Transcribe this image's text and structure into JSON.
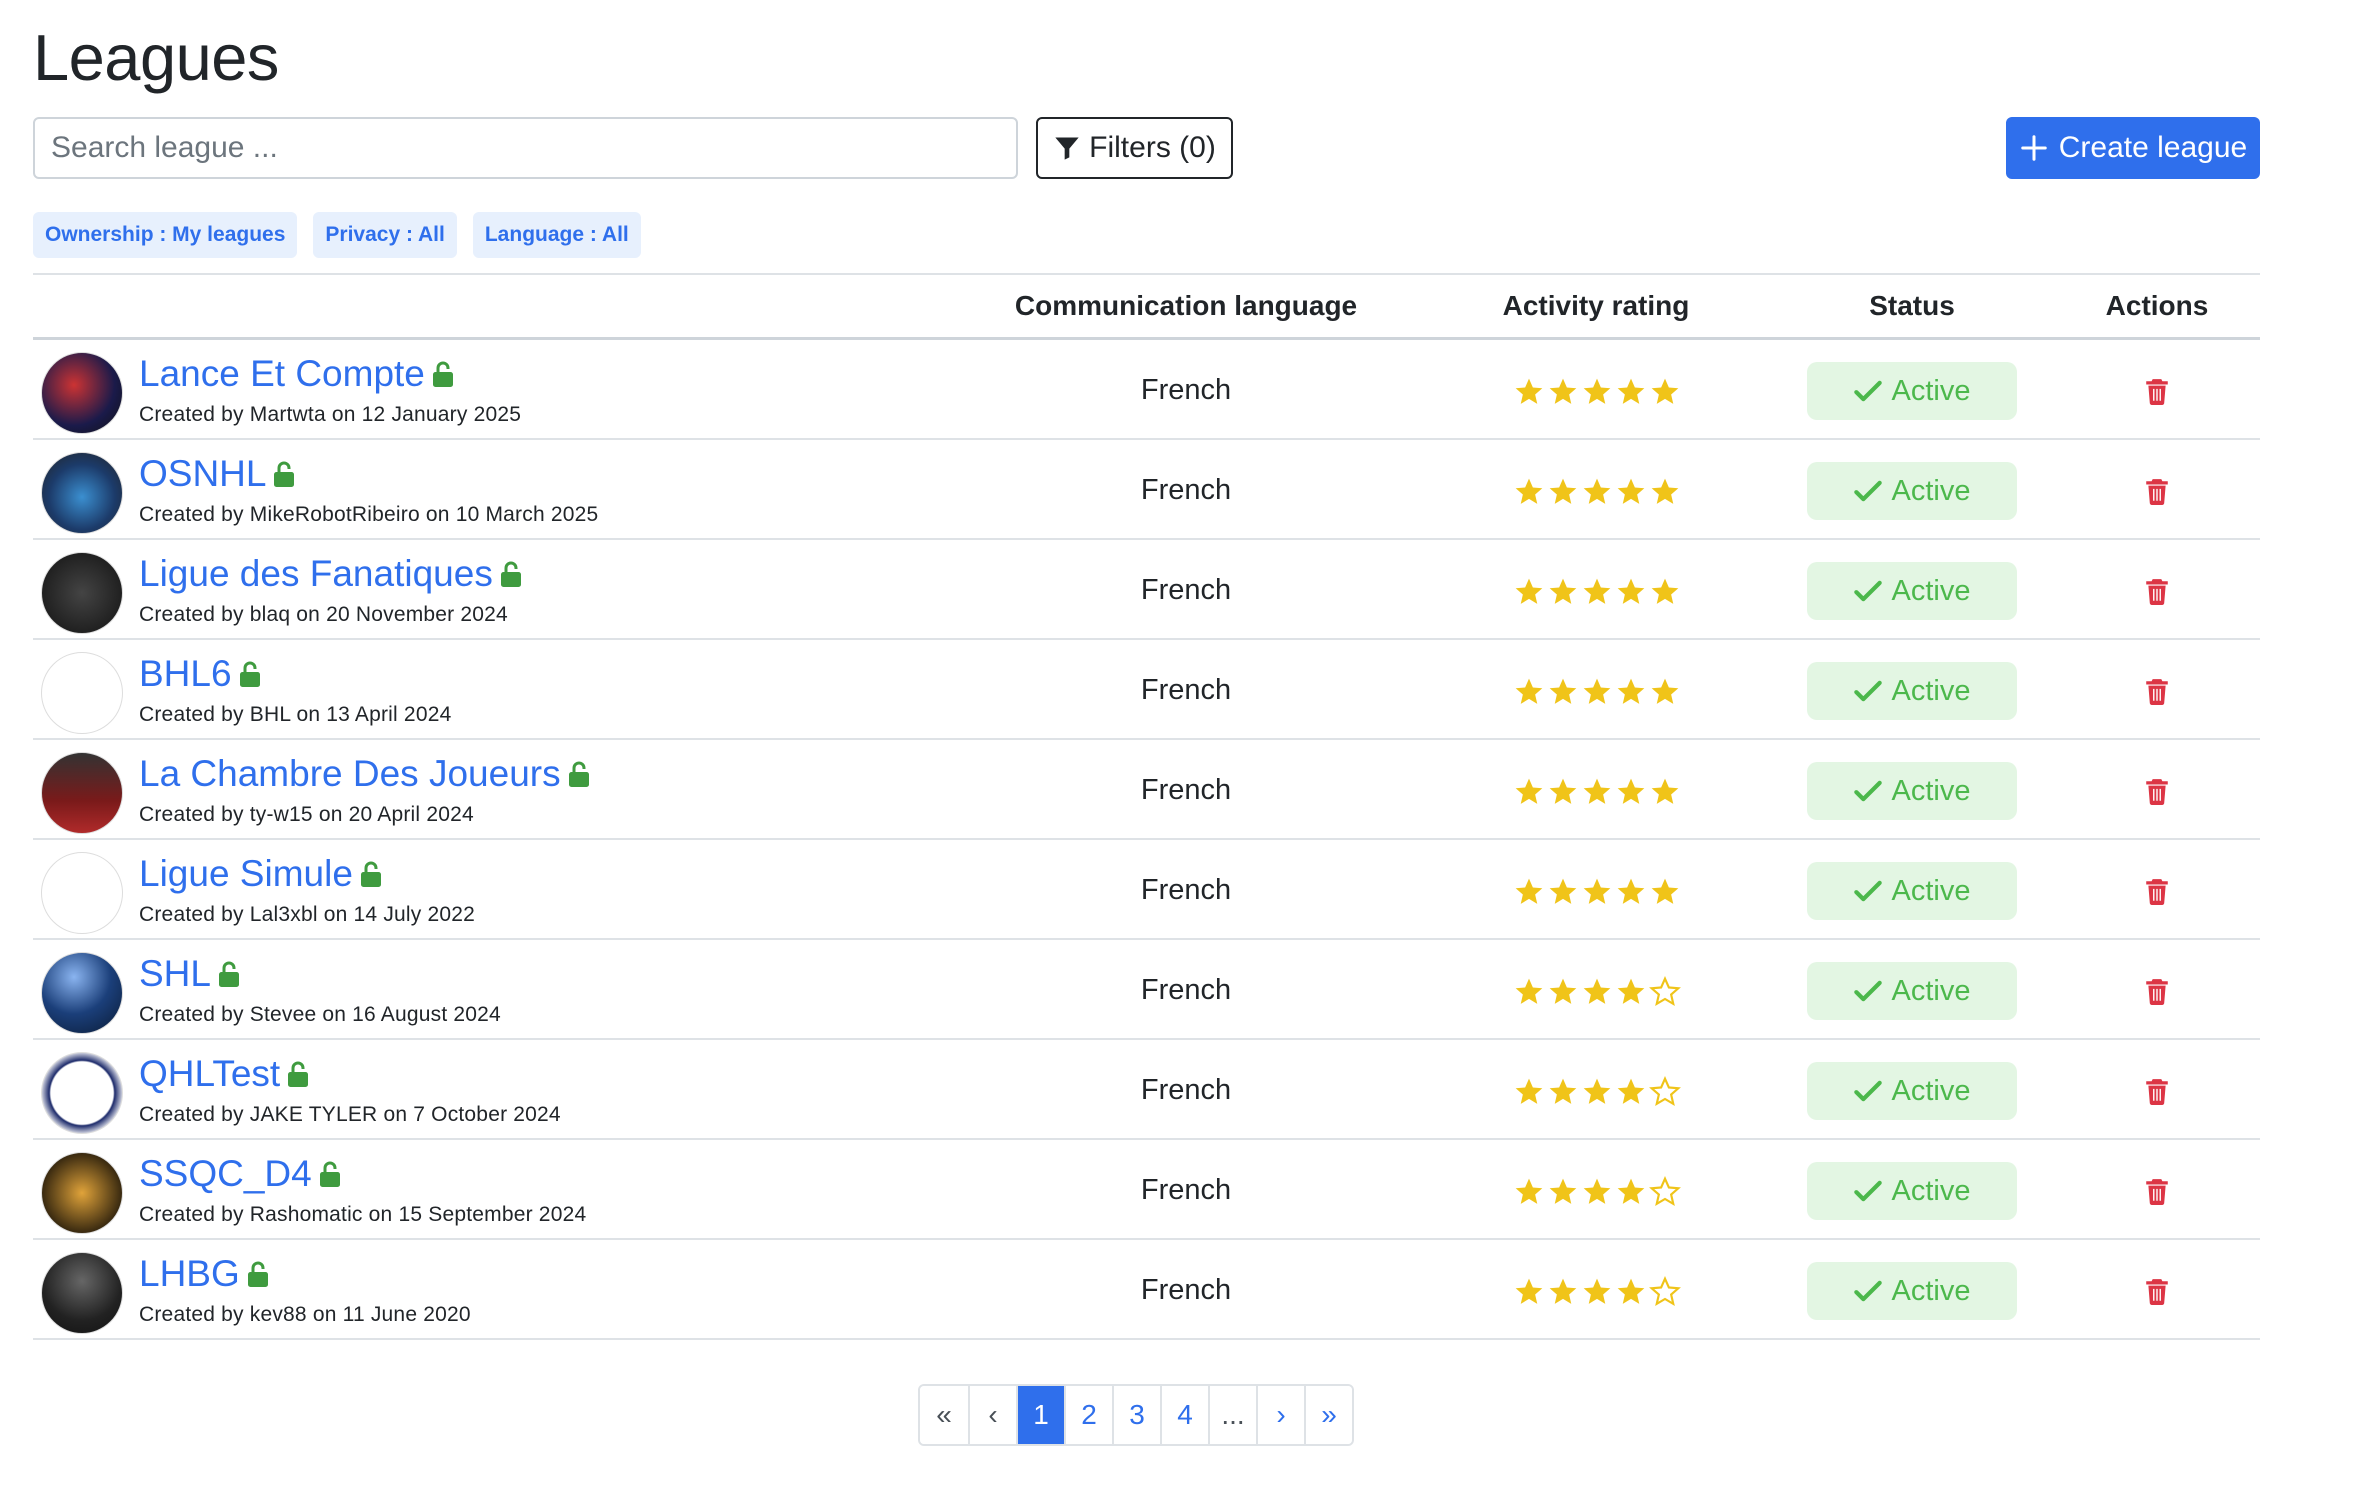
{
  "page": {
    "title": "Leagues"
  },
  "search": {
    "placeholder": "Search league ..."
  },
  "filters_button": {
    "label": "Filters (0)"
  },
  "create_button": {
    "label": "Create league"
  },
  "chips": [
    {
      "label": "Ownership : My leagues"
    },
    {
      "label": "Privacy : All"
    },
    {
      "label": "Language : All"
    }
  ],
  "table": {
    "headers": {
      "language": "Communication language",
      "activity": "Activity rating",
      "status": "Status",
      "actions": "Actions"
    },
    "rows": [
      {
        "name": "Lance Et Compte",
        "created": "Created by Martwta on 12 January 2025",
        "language": "French",
        "rating": 5,
        "status": "Active"
      },
      {
        "name": "OSNHL",
        "created": "Created by MikeRobotRibeiro on 10 March 2025",
        "language": "French",
        "rating": 5,
        "status": "Active"
      },
      {
        "name": "Ligue des Fanatiques",
        "created": "Created by blaq on 20 November 2024",
        "language": "French",
        "rating": 5,
        "status": "Active"
      },
      {
        "name": "BHL6",
        "created": "Created by BHL on 13 April 2024",
        "language": "French",
        "rating": 5,
        "status": "Active"
      },
      {
        "name": "La Chambre Des Joueurs",
        "created": "Created by ty-w15 on 20 April 2024",
        "language": "French",
        "rating": 5,
        "status": "Active"
      },
      {
        "name": "Ligue Simule",
        "created": "Created by Lal3xbl on 14 July 2022",
        "language": "French",
        "rating": 5,
        "status": "Active"
      },
      {
        "name": "SHL",
        "created": "Created by Stevee on 16 August 2024",
        "language": "French",
        "rating": 4,
        "status": "Active"
      },
      {
        "name": "QHLTest",
        "created": "Created by JAKE TYLER on 7 October 2024",
        "language": "French",
        "rating": 4,
        "status": "Active"
      },
      {
        "name": "SSQC_D4",
        "created": "Created by Rashomatic on 15 September 2024",
        "language": "French",
        "rating": 4,
        "status": "Active"
      },
      {
        "name": "LHBG",
        "created": "Created by kev88 on 11 June 2020",
        "language": "French",
        "rating": 4,
        "status": "Active"
      }
    ]
  },
  "pagination": {
    "first": "«",
    "prev": "‹",
    "pages": [
      "1",
      "2",
      "3",
      "4"
    ],
    "ellipsis": "...",
    "next": "›",
    "last": "»",
    "current": "1"
  },
  "colors": {
    "primary": "#2f6fec",
    "success": "#4cb84c",
    "success_bg": "#e3f6e3",
    "star": "#f0c419",
    "danger": "#dc3545",
    "lock": "#3f9b3f"
  }
}
